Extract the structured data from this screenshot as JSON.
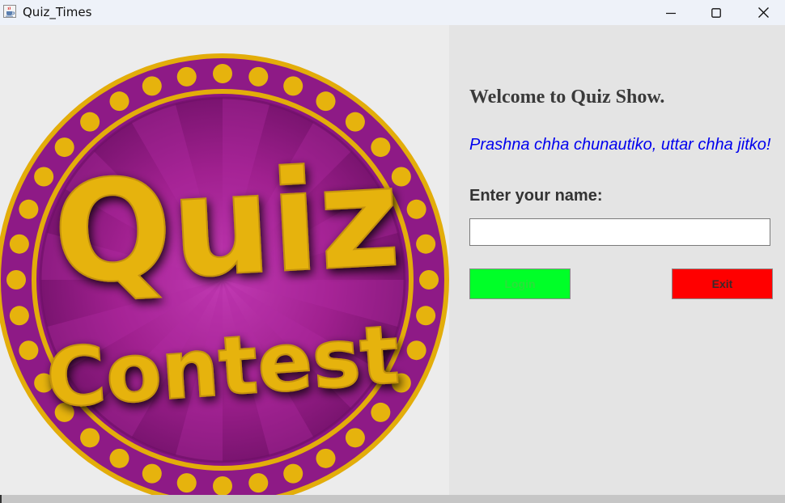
{
  "window": {
    "title": "Quiz_Times",
    "icon": "java-cup-icon",
    "controls": [
      "minimize-icon",
      "maximize-icon",
      "close-icon"
    ]
  },
  "logo": {
    "text_line1": "Quiz",
    "text_line2": "Contest",
    "colors": {
      "purple": "#8e1a86",
      "gold": "#e6b30d",
      "background": "#ececec"
    }
  },
  "panel": {
    "heading": "Welcome to Quiz Show.",
    "tagline": "Prashna chha chunautiko, uttar chha jitko!",
    "name_label": "Enter your name:",
    "name_value": "",
    "login_label": "Login",
    "exit_label": "Exit",
    "colors": {
      "tagline": "#0000ee",
      "login_bg": "#00ff28",
      "exit_bg": "#ff0000"
    }
  }
}
